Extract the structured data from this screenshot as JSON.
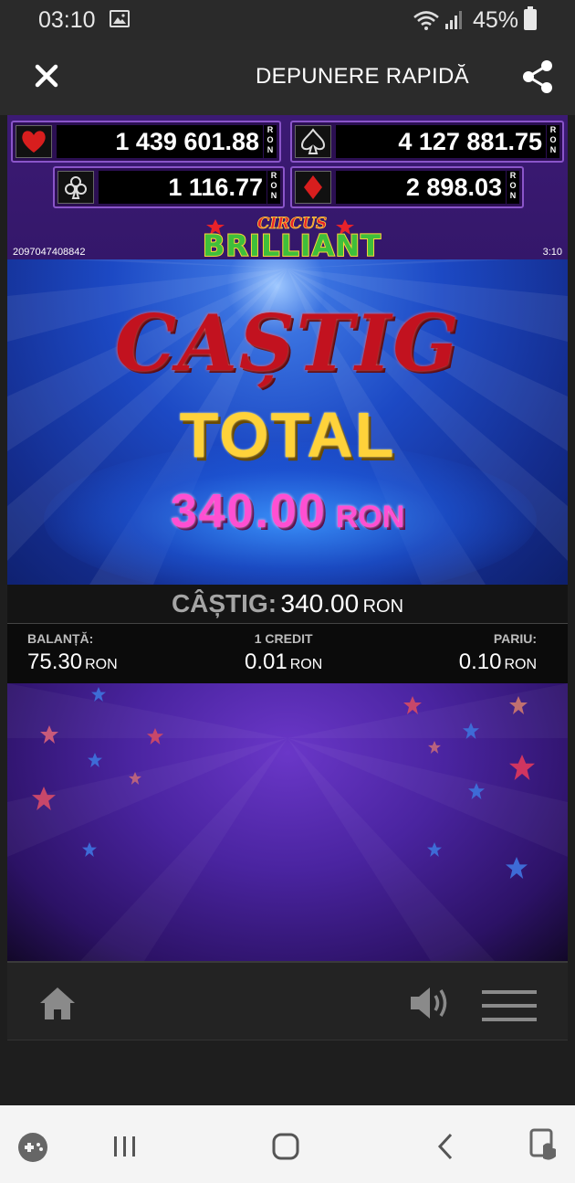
{
  "status_bar": {
    "time": "03:10",
    "battery": "45%"
  },
  "app_bar": {
    "title": "DEPUNERE RAPIDĂ"
  },
  "jackpots": [
    {
      "suit": "heart-icon",
      "value": "1 439 601.88",
      "currency": "RON"
    },
    {
      "suit": "spade-icon",
      "value": "4 127 881.75",
      "currency": "RON"
    },
    {
      "suit": "club-icon",
      "value": "1 116.77",
      "currency": "RON"
    },
    {
      "suit": "diamond-icon",
      "value": "2 898.03",
      "currency": "RON"
    }
  ],
  "game": {
    "id": "2097047408842",
    "clock": "3:10",
    "logo_top": "CIRCUS",
    "logo_main": "BRILLIANT"
  },
  "win_screen": {
    "title": "CAȘTIG",
    "subtitle": "TOTAL",
    "amount": "340.00",
    "currency": "RON"
  },
  "win_bar": {
    "label": "CÂȘTIG:",
    "amount": "340.00",
    "currency": "RON"
  },
  "info": {
    "balance_label": "BALANȚĂ:",
    "balance_value": "75.30",
    "credit_label": "1 CREDIT",
    "credit_value": "0.01",
    "bet_label": "PARIU:",
    "bet_value": "0.10",
    "currency": "RON"
  },
  "colors": {
    "heart": "#d81e1e",
    "diamond": "#d81e1e",
    "win_title": "#c2121f",
    "win_total": "#ffd23a",
    "win_amount": "#ff4fd2"
  }
}
